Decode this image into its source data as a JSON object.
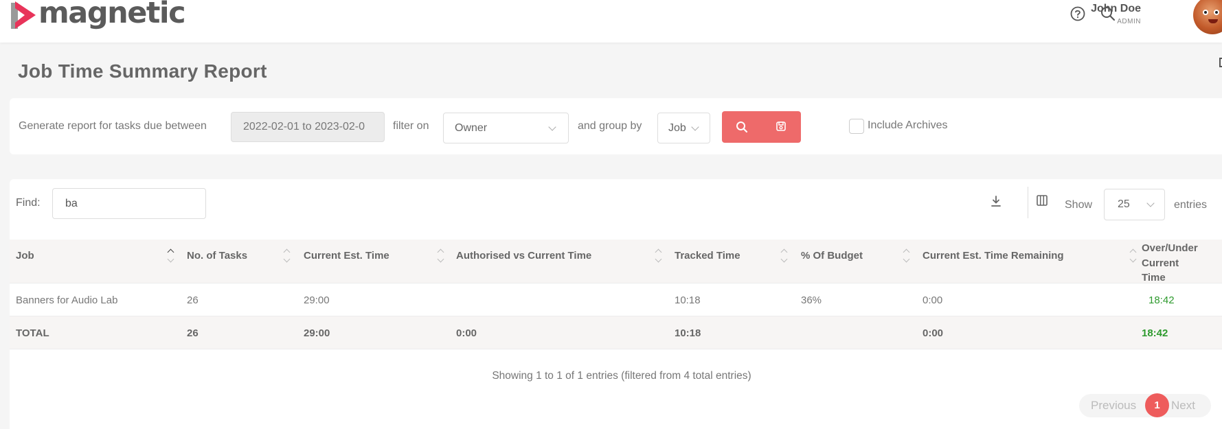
{
  "brand": {
    "name": "magnetic",
    "accent": "#e8345a"
  },
  "user": {
    "name": "John Doe",
    "role": "ADMIN"
  },
  "page": {
    "title": "Job Time Summary Report"
  },
  "filters": {
    "label_due_between": "Generate report for tasks due between",
    "date_range": "2022-02-01 to 2023-02-0",
    "label_filter_on": "filter on",
    "filter_value": "Owner",
    "label_group_by": "and group by",
    "group_value": "Job",
    "include_archives_label": "Include Archives",
    "include_archives_checked": false,
    "button_color": "#ee6a6a"
  },
  "table_tools": {
    "find_label": "Find:",
    "find_value": "ba",
    "show_label": "Show",
    "page_size": "25",
    "entries_label": "entries"
  },
  "table": {
    "columns": [
      "Job",
      "No. of Tasks",
      "Current Est. Time",
      "Authorised vs Current Time",
      "Tracked Time",
      "% Of Budget",
      "Current Est. Time Remaining",
      "Over/Under Current Time"
    ],
    "over_under_lines": [
      "Over/Under",
      "Current",
      "Time"
    ],
    "rows": [
      [
        "Banners for Audio Lab",
        "26",
        "29:00",
        "",
        "10:18",
        "36%",
        "0:00",
        "18:42"
      ]
    ],
    "total": [
      "TOTAL",
      "26",
      "29:00",
      "0:00",
      "10:18",
      "",
      "0:00",
      "18:42"
    ]
  },
  "footer": {
    "info": "Showing 1 to 1 of 1 entries (filtered from 4 total entries)",
    "prev": "Previous",
    "page": "1",
    "next": "Next"
  }
}
